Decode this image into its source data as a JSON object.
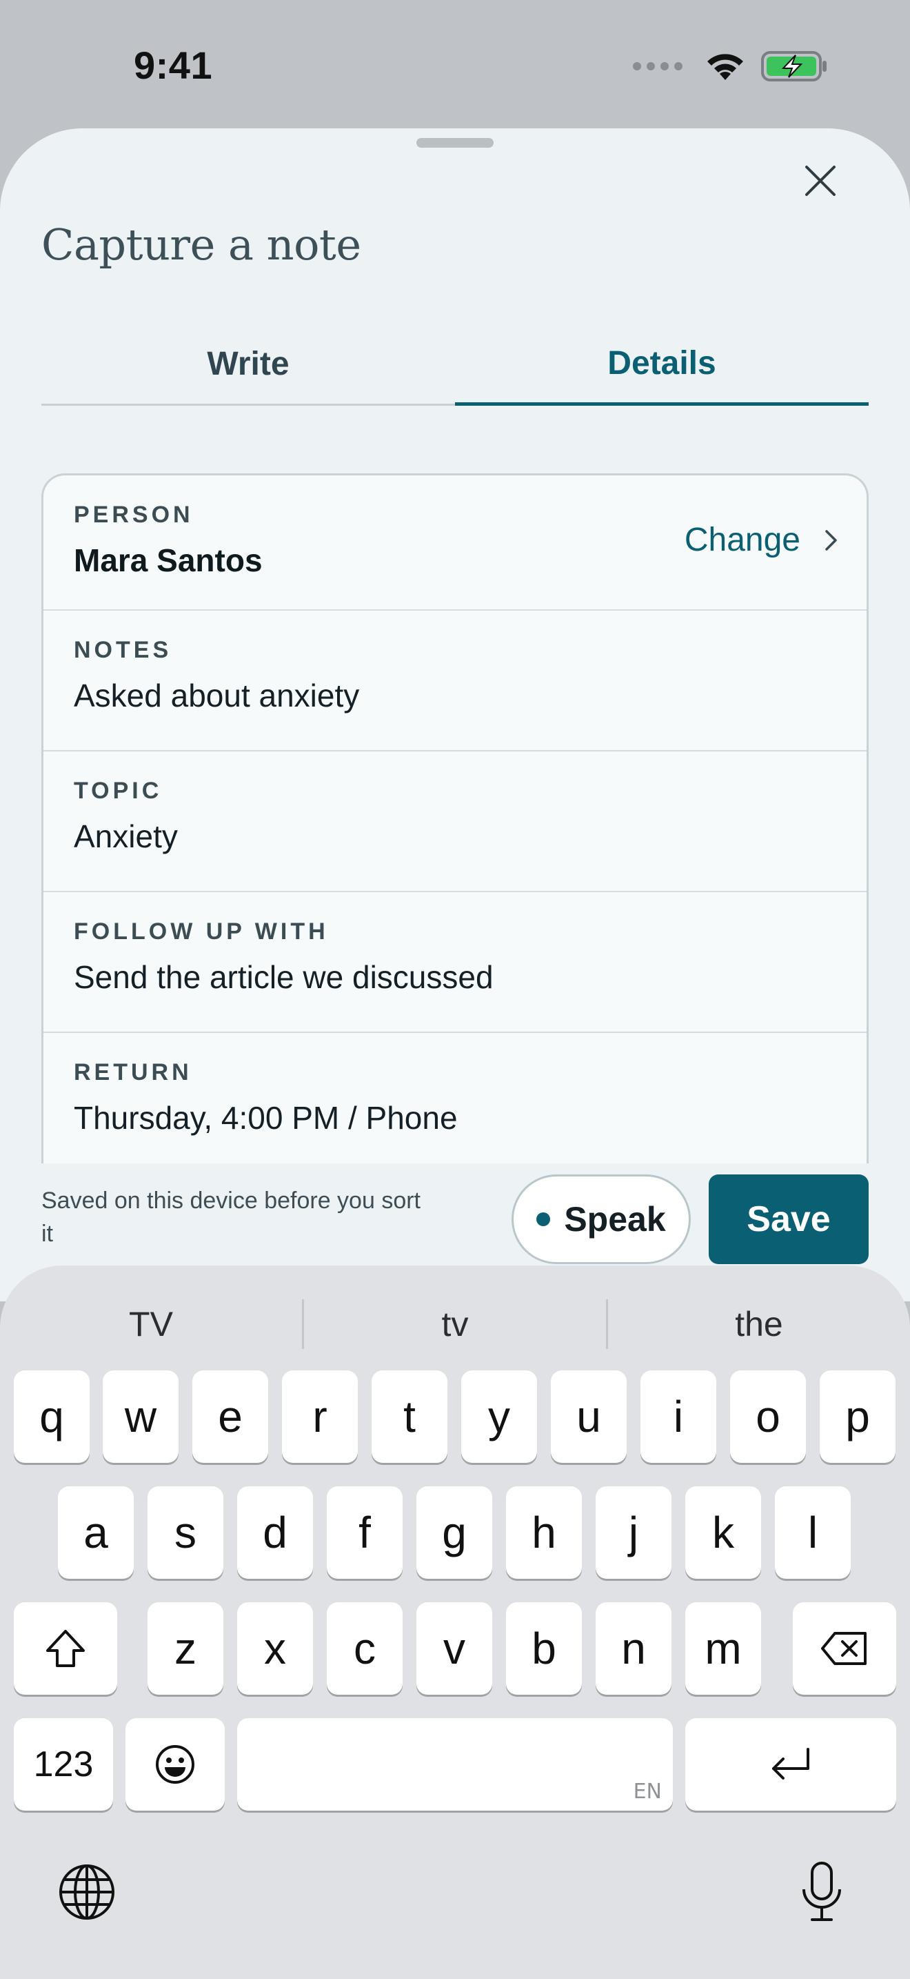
{
  "status_bar": {
    "time": "9:41"
  },
  "sheet": {
    "title": "Capture a note",
    "tabs": [
      {
        "label": "Write",
        "active": false
      },
      {
        "label": "Details",
        "active": true
      }
    ],
    "fields": {
      "person": {
        "label": "PERSON",
        "value": "Mara Santos",
        "action": "Change"
      },
      "notes": {
        "label": "NOTES",
        "value": "Asked about anxiety"
      },
      "topic": {
        "label": "TOPIC",
        "value": "Anxiety"
      },
      "follow_up": {
        "label": "FOLLOW UP WITH",
        "value": "Send the article we discussed"
      },
      "return": {
        "label": "RETURN",
        "value": "Thursday, 4:00 PM / Phone"
      }
    },
    "saved_note": "Saved on this device before you sort it",
    "speak_label": "Speak",
    "save_label": "Save"
  },
  "keyboard": {
    "suggestions": [
      "TV",
      "tv",
      "the"
    ],
    "row1": [
      "q",
      "w",
      "e",
      "r",
      "t",
      "y",
      "u",
      "i",
      "o",
      "p"
    ],
    "row2": [
      "a",
      "s",
      "d",
      "f",
      "g",
      "h",
      "j",
      "k",
      "l"
    ],
    "row3": [
      "z",
      "x",
      "c",
      "v",
      "b",
      "n",
      "m"
    ],
    "numbers_key": "123",
    "space_language": "EN"
  },
  "colors": {
    "accent": "#0b5f72",
    "sheet_bg": "#edf3f5",
    "keyboard_bg": "#dfe1e4"
  }
}
